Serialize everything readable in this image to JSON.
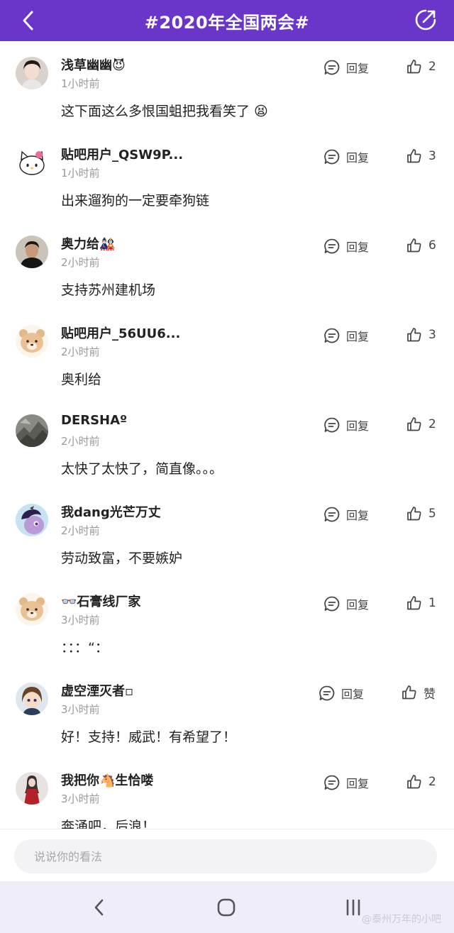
{
  "header": {
    "title": "#2020年全国两会#",
    "icons": {
      "back": "back-arrow-icon",
      "share": "share-icon"
    }
  },
  "comments": [
    {
      "name": "浅草幽幽😈",
      "time": "1小时前",
      "content": "这下面这么多恨国蛆把我看笑了 😫",
      "reply_label": "回复",
      "likes": "2",
      "avatar": "avatar-woman"
    },
    {
      "name": "贴吧用户_QSW9P...",
      "time": "1小时前",
      "content": "出来遛狗的一定要牵狗链",
      "reply_label": "回复",
      "likes": "3",
      "avatar": "avatar-hello-kitty"
    },
    {
      "name": "奥力给🎎",
      "time": "2小时前",
      "content": "支持苏州建机场",
      "reply_label": "回复",
      "likes": "6",
      "avatar": "avatar-man-dark"
    },
    {
      "name": "贴吧用户_56UU6...",
      "time": "2小时前",
      "content": "奥利给",
      "reply_label": "回复",
      "likes": "3",
      "avatar": "avatar-bear"
    },
    {
      "name": "DERSHAº",
      "time": "2小时前",
      "content": "太快了太快了，简直像。。。",
      "reply_label": "回复",
      "likes": "2",
      "avatar": "avatar-gray-texture"
    },
    {
      "name": "我dang光芒万丈",
      "time": "2小时前",
      "content": "劳动致富，不要嫉妒",
      "reply_label": "回复",
      "likes": "5",
      "avatar": "avatar-pony"
    },
    {
      "name": "👓石膏线厂家",
      "time": "3小时前",
      "content": "：：：“：",
      "reply_label": "回复",
      "likes": "1",
      "avatar": "avatar-bear"
    },
    {
      "name": "虚空湮灭者▫",
      "time": "3小时前",
      "content": "好！支持！威武！有希望了！",
      "reply_label": "回复",
      "likes": "赞",
      "avatar": "avatar-anime"
    },
    {
      "name": "我把你🐴生恰喽",
      "time": "3小时前",
      "content": "奔涌吧，后浪！",
      "reply_label": "回复",
      "likes": "2",
      "avatar": "avatar-red-dress"
    }
  ],
  "composer": {
    "placeholder": "说说你的看法"
  },
  "navbar": {
    "back": "nav-back-icon",
    "home": "nav-home-icon",
    "recents": "nav-recents-icon"
  },
  "watermark": "@泰州万年的小吧",
  "colors": {
    "header": "#6a36c9",
    "navbar": "#efedf7",
    "input": "#f3f3f5"
  }
}
